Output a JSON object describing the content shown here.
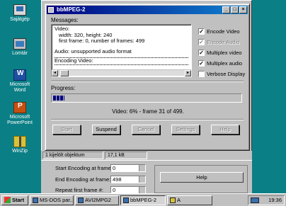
{
  "desktop": {
    "icons": [
      {
        "label": "Sajátgép",
        "icon": "my-computer-icon"
      },
      {
        "label": "Lomtár",
        "icon": "recycle-bin-icon"
      },
      {
        "label": "Microsoft Word",
        "icon": "word-icon"
      },
      {
        "label": "Microsoft PowerPoint",
        "icon": "powerpoint-icon"
      },
      {
        "label": "WinZip",
        "icon": "winzip-icon"
      }
    ]
  },
  "back_window": {
    "status": {
      "objects": "1 kijelölt objektum",
      "size": "17,1 kB"
    }
  },
  "settings": {
    "start_label": "Start Encoding at frame:",
    "start_value": "0",
    "end_label": "End Encoding at frame:",
    "end_value": "498",
    "repeat_label": "Repeat first frame #:",
    "repeat_value": "0",
    "help_label": "Help"
  },
  "dialog": {
    "title": "bbMPEG-2",
    "messages_label": "Messages:",
    "messages": [
      "Video:",
      "  width: 320, height: 240",
      "  first frame: 0, number of frames: 499",
      "",
      "Audio: unsupported audio format"
    ],
    "encoding_line": "Encoding Video:",
    "checkboxes": [
      {
        "label": "Encode Video",
        "checked": true,
        "enabled": true
      },
      {
        "label": "Encode Audio",
        "checked": true,
        "enabled": false
      },
      {
        "label": "Multiplex video",
        "checked": true,
        "enabled": true
      },
      {
        "label": "Multiplex audio",
        "checked": true,
        "enabled": true
      },
      {
        "label": "Verbose Display",
        "checked": false,
        "enabled": true
      }
    ],
    "progress_label": "Progress:",
    "progress_value": 0.06,
    "progress_text": "Video: 6% - frame 31 of 499.",
    "buttons": [
      {
        "label": "Start",
        "enabled": false
      },
      {
        "label": "Suspend",
        "enabled": true
      },
      {
        "label": "Cancel",
        "enabled": false
      },
      {
        "label": "Settings",
        "enabled": false
      },
      {
        "label": "Help",
        "enabled": false
      }
    ]
  },
  "taskbar": {
    "start_label": "Start",
    "items": [
      {
        "label": "MS-DOS par...",
        "active": false
      },
      {
        "label": "AVI2MPG2",
        "active": false
      },
      {
        "label": "bbMPEG-2",
        "active": true
      },
      {
        "label": "A",
        "active": false
      }
    ],
    "clock": "19:36"
  }
}
